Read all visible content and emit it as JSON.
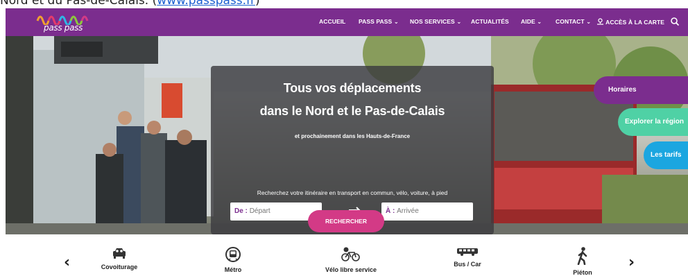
{
  "intro": {
    "text": "Nord et du Pas-de-Calais. (",
    "link": "www.passpass.fr",
    "suffix": ")"
  },
  "brand": {
    "logo_text": "pass pass"
  },
  "nav": {
    "items": [
      {
        "label": "ACCUEIL"
      },
      {
        "label": "PASS PASS ⌄"
      },
      {
        "label": "NOS SERVICES ⌄"
      },
      {
        "label": "ACTUALITÉS"
      },
      {
        "label": "AIDE ⌄"
      },
      {
        "label": "CONTACT ⌄"
      }
    ],
    "map_label": "ACCÈS À LA CARTE",
    "search_icon": "search-icon"
  },
  "hero": {
    "title_line1": "Tous vos déplacements",
    "title_line2": "dans le Nord et le Pas-de-Calais",
    "subtitle": "et prochainement dans les Hauts-de-France",
    "prompt": "Recherchez votre itinéraire en transport en commun, vélo, voiture, à pied",
    "from_label": "De :",
    "from_placeholder": "Départ",
    "to_label": "À :",
    "to_placeholder": "Arrivée",
    "search_button": "RECHERCHER"
  },
  "side_tabs": [
    {
      "label": "Horaires",
      "color": "#7b2d8e"
    },
    {
      "label": "Explorer la région",
      "color": "#4fd1a5"
    },
    {
      "label": "Les tarifs",
      "color": "#1ba6e0"
    }
  ],
  "modes": {
    "prev": "‹",
    "next": "›",
    "items": [
      {
        "label": "Covoiturage",
        "icon": "carpool-icon"
      },
      {
        "label": "Métro",
        "icon": "metro-icon"
      },
      {
        "label": "Vélo libre service",
        "icon": "bike-share-icon"
      },
      {
        "label": "Bus / Car",
        "icon": "bus-icon"
      },
      {
        "label": "Piéton",
        "icon": "pedestrian-icon"
      }
    ]
  },
  "colors": {
    "brand_purple": "#7b2d8e",
    "accent_pink": "#d33a86",
    "accent_green": "#4fd1a5",
    "accent_blue": "#1ba6e0"
  }
}
